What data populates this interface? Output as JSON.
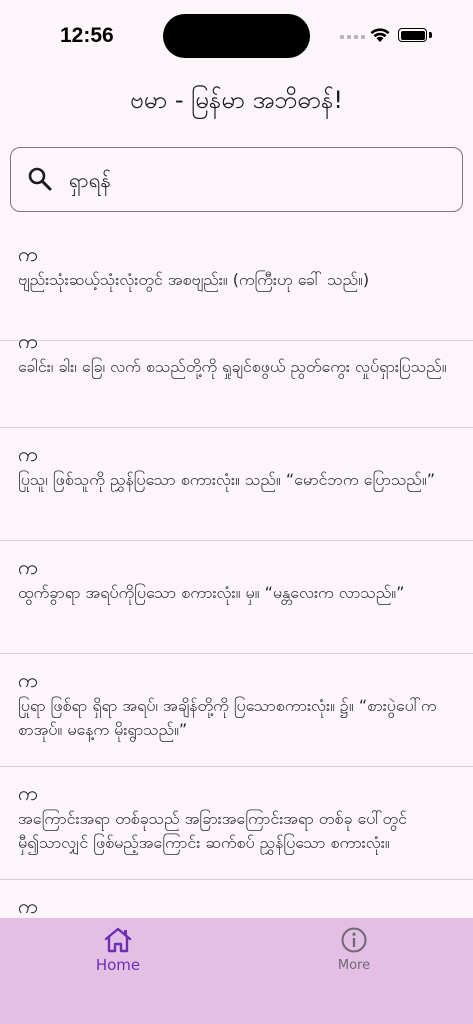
{
  "status_bar": {
    "time": "12:56"
  },
  "app": {
    "title": "ဗမာ - မြန်မာ အဘိဓာန်!"
  },
  "search": {
    "placeholder": "ရှာရန်",
    "value": ""
  },
  "words": [
    {
      "headword": "က",
      "definition": "ဗျည်းသုံးဆယ့်သုံးလုံးတွင် အစဗျည်း။ (ကကြီးဟု ခေါ် သည်။)"
    },
    {
      "headword": "က",
      "definition": "ခေါင်း၊ ခါး၊ ခြေ၊ လက် စသည်တို့ကို ရှုချင်စဖွယ် ညွတ်ကွေး လှုပ်ရှားပြသည်။"
    },
    {
      "headword": "က",
      "definition": "ပြုသူ၊ ဖြစ်သူကို ညွှန်ပြသော စကားလုံး။ သည်။ “မောင်ဘက ပြောသည်။”"
    },
    {
      "headword": "က",
      "definition": "ထွက်ခွာရာ အရပ်ကိုပြသော စကားလုံး။ မှ။ “မန္တလေးက လာသည်။”"
    },
    {
      "headword": "က",
      "definition": "ပြုရာ ဖြစ်ရာ ရှိရာ အရပ်၊ အချိန်တို့ကို ပြသောစကားလုံး။ ၌။ “စားပွဲပေါ်က စာအုပ်။ မနေ့က မိုးရွာသည်။”"
    },
    {
      "headword": "က",
      "definition": "အကြောင်းအရာ တစ်ခုသည် အခြားအကြောင်းအရာ တစ်ခု ပေါ်တွင် မှီ၍သာလျှင် ဖြစ်မည့်အကြောင်း ဆက်စပ် ညွှန်ပြသော စကားလုံး။"
    },
    {
      "headword": "က",
      "definition": ""
    }
  ],
  "bottom_nav": {
    "home_label": "Home",
    "more_label": "More",
    "active_color": "#6b2fb3",
    "background": "#e3bfe6"
  }
}
